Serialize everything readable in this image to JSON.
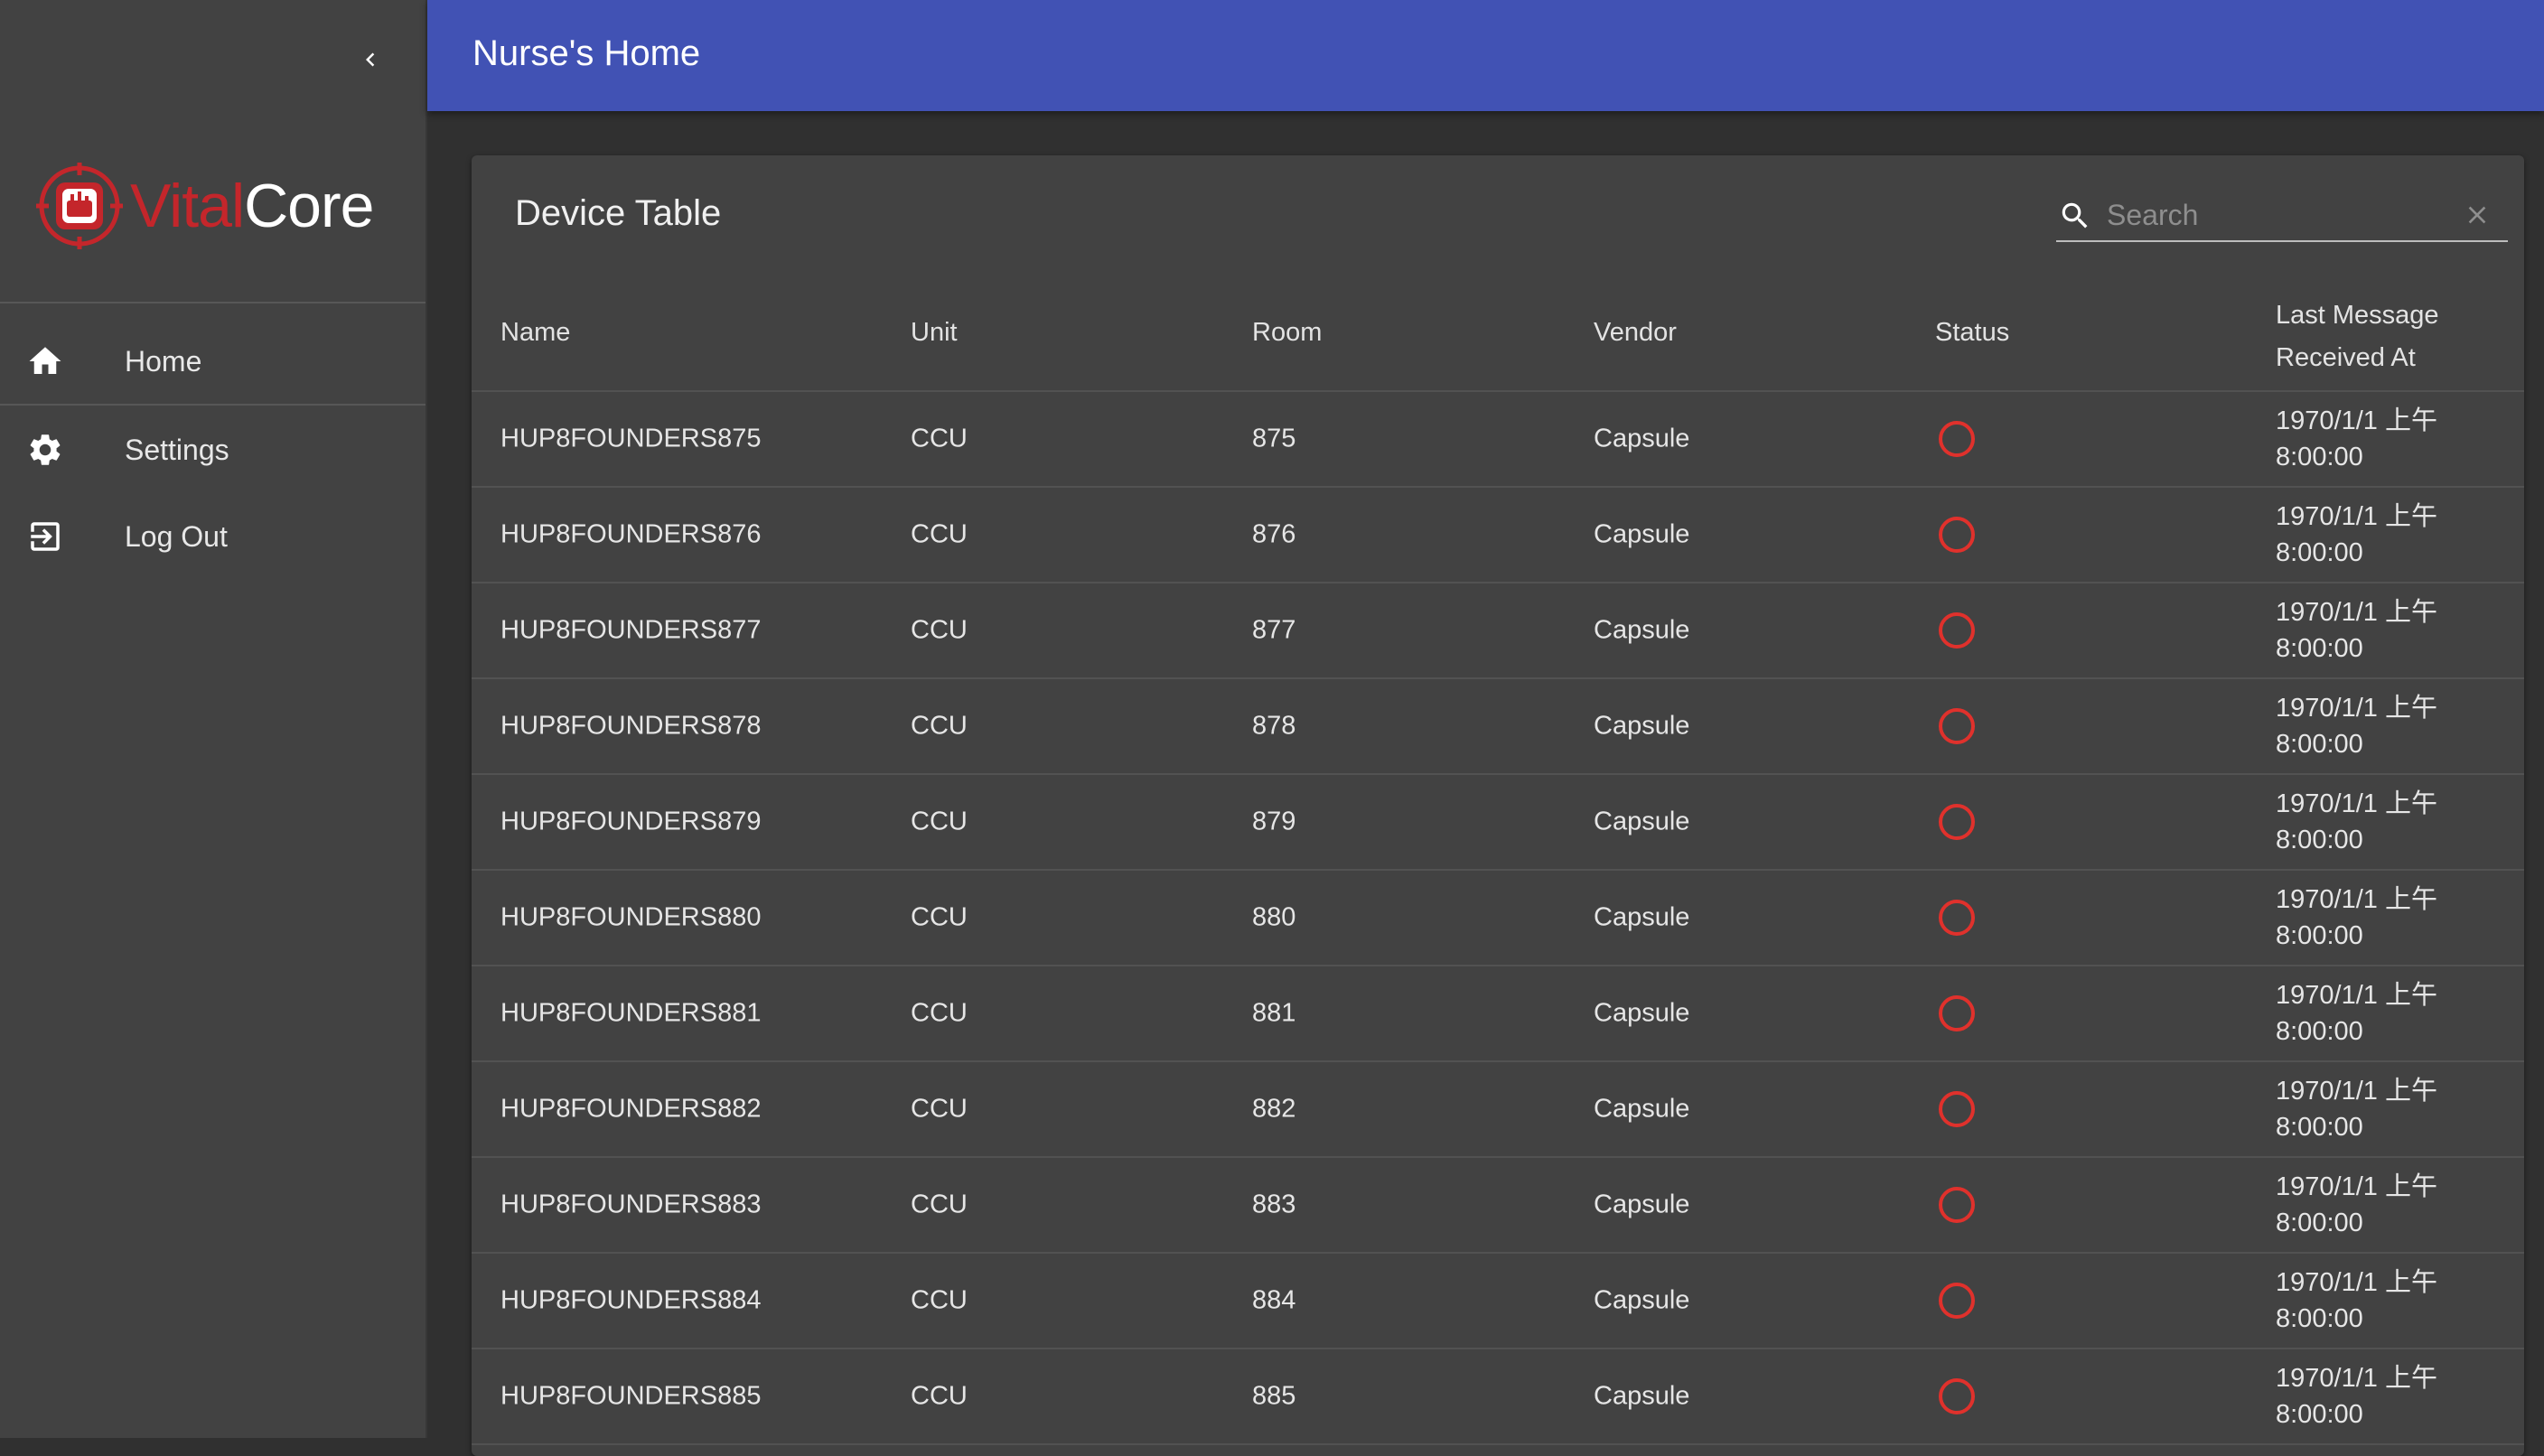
{
  "sidebar": {
    "logo": {
      "vital": "Vital",
      "core": "Core"
    },
    "items": [
      {
        "label": "Home",
        "icon": "home-icon"
      },
      {
        "label": "Settings",
        "icon": "gear-icon"
      },
      {
        "label": "Log Out",
        "icon": "logout-icon"
      }
    ]
  },
  "header": {
    "title": "Nurse's Home"
  },
  "card": {
    "title": "Device Table",
    "search": {
      "placeholder": "Search",
      "value": ""
    }
  },
  "table": {
    "columns": [
      "Name",
      "Unit",
      "Room",
      "Vendor",
      "Status",
      "Last Message Received At"
    ],
    "rows": [
      {
        "name": "HUP8FOUNDERS875",
        "unit": "CCU",
        "room": "875",
        "vendor": "Capsule",
        "status": "offline",
        "time": "1970/1/1 上午 8:00:00"
      },
      {
        "name": "HUP8FOUNDERS876",
        "unit": "CCU",
        "room": "876",
        "vendor": "Capsule",
        "status": "offline",
        "time": "1970/1/1 上午 8:00:00"
      },
      {
        "name": "HUP8FOUNDERS877",
        "unit": "CCU",
        "room": "877",
        "vendor": "Capsule",
        "status": "offline",
        "time": "1970/1/1 上午 8:00:00"
      },
      {
        "name": "HUP8FOUNDERS878",
        "unit": "CCU",
        "room": "878",
        "vendor": "Capsule",
        "status": "offline",
        "time": "1970/1/1 上午 8:00:00"
      },
      {
        "name": "HUP8FOUNDERS879",
        "unit": "CCU",
        "room": "879",
        "vendor": "Capsule",
        "status": "offline",
        "time": "1970/1/1 上午 8:00:00"
      },
      {
        "name": "HUP8FOUNDERS880",
        "unit": "CCU",
        "room": "880",
        "vendor": "Capsule",
        "status": "offline",
        "time": "1970/1/1 上午 8:00:00"
      },
      {
        "name": "HUP8FOUNDERS881",
        "unit": "CCU",
        "room": "881",
        "vendor": "Capsule",
        "status": "offline",
        "time": "1970/1/1 上午 8:00:00"
      },
      {
        "name": "HUP8FOUNDERS882",
        "unit": "CCU",
        "room": "882",
        "vendor": "Capsule",
        "status": "offline",
        "time": "1970/1/1 上午 8:00:00"
      },
      {
        "name": "HUP8FOUNDERS883",
        "unit": "CCU",
        "room": "883",
        "vendor": "Capsule",
        "status": "offline",
        "time": "1970/1/1 上午 8:00:00"
      },
      {
        "name": "HUP8FOUNDERS884",
        "unit": "CCU",
        "room": "884",
        "vendor": "Capsule",
        "status": "offline",
        "time": "1970/1/1 上午 8:00:00"
      },
      {
        "name": "HUP8FOUNDERS885",
        "unit": "CCU",
        "room": "885",
        "vendor": "Capsule",
        "status": "offline",
        "time": "1970/1/1 上午 8:00:00"
      }
    ]
  },
  "colors": {
    "header_bg": "#4152b4",
    "sidebar_bg": "#424242",
    "page_bg": "#303030",
    "status_offline": "#e0312c",
    "brand_red": "#c4262b"
  }
}
